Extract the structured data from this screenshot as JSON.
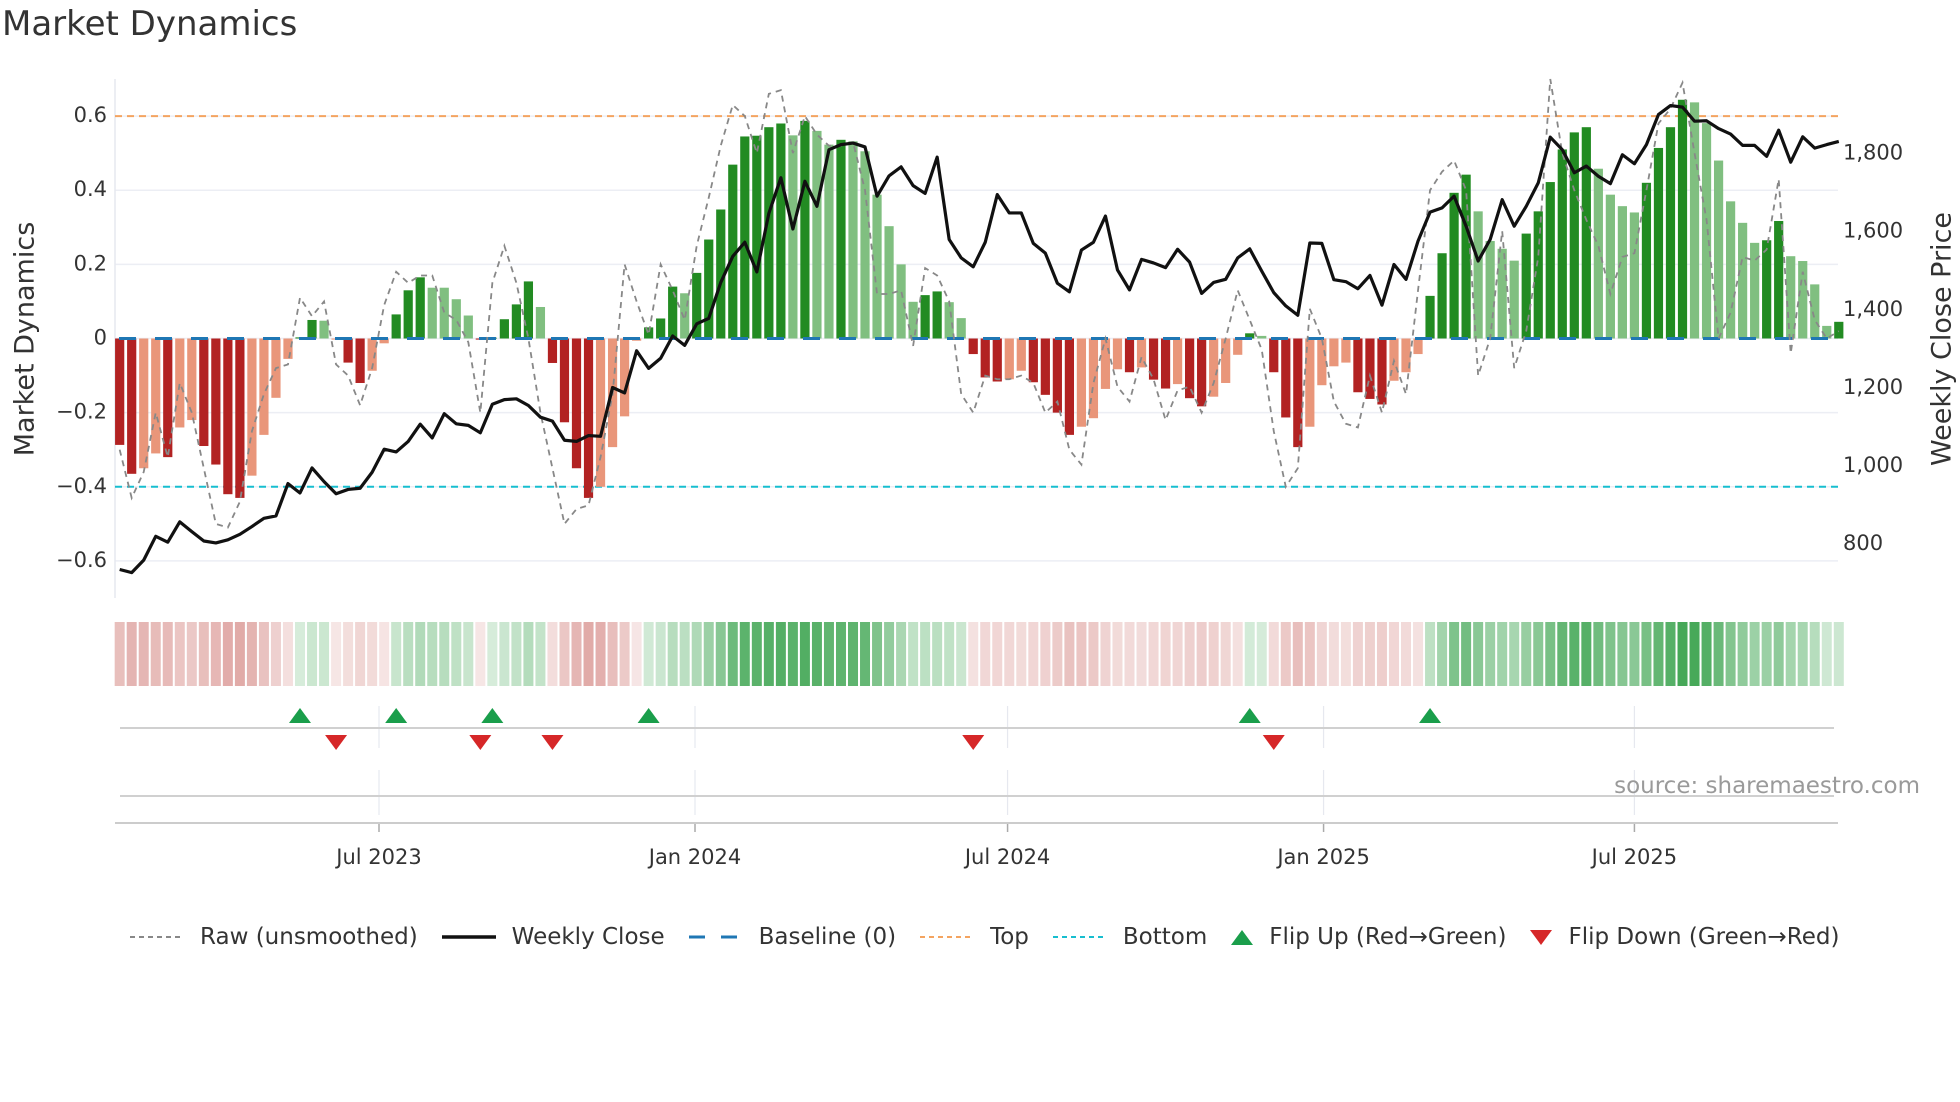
{
  "title": "Market Dynamics",
  "source": "source: sharemaestro.com",
  "colors": {
    "dark_red": "#b22222",
    "light_red": "#e9967a",
    "dark_green": "#228b22",
    "light_green": "#80bf80",
    "baseline": "#1f77b4",
    "top": "#f4a460",
    "bottom": "#17becf",
    "flip_up": "#1a9e4b",
    "flip_down": "#d62728",
    "close": "#111111",
    "raw": "#888888"
  },
  "legend": [
    {
      "key": "raw",
      "label": "Raw (unsmoothed)"
    },
    {
      "key": "close",
      "label": "Weekly Close"
    },
    {
      "key": "baseline",
      "label": "Baseline (0)"
    },
    {
      "key": "top",
      "label": "Top"
    },
    {
      "key": "bottom",
      "label": "Bottom"
    },
    {
      "key": "flip_up",
      "label": "Flip Up (Red→Green)"
    },
    {
      "key": "flip_down",
      "label": "Flip Down (Green→Red)"
    }
  ],
  "chart_data": {
    "type": "bar",
    "title": "Market Dynamics",
    "ylabel": "Market Dynamics",
    "y2label": "Weekly Close Price",
    "ylim": [
      -0.7,
      0.7
    ],
    "y2lim": [
      662,
      1991
    ],
    "yticks": [
      0.6,
      0.4,
      0.2,
      0,
      -0.2,
      -0.4,
      -0.6
    ],
    "ytick_labels": [
      "0.6",
      "0.4",
      "0.2",
      "0",
      "−0.2",
      "−0.4",
      "−0.6"
    ],
    "y2ticks": [
      800,
      1000,
      1200,
      1400,
      1600,
      1800
    ],
    "y2tick_labels": [
      "800",
      "1,000",
      "1,200",
      "1,400",
      "1,600",
      "1,800"
    ],
    "xticks": [
      "2023-07-01",
      "2024-01-01",
      "2024-07-01",
      "2025-01-01",
      "2025-07-01"
    ],
    "xtick_labels": [
      "Jul 2023",
      "Jan 2024",
      "Jul 2024",
      "Jan 2025",
      "Jul 2025"
    ],
    "start_date": "2023-01-31",
    "frequency_days": 7,
    "grid": true,
    "legend_position": "bottom",
    "top_level": 0.6,
    "bottom_level": -0.4,
    "baseline": 0,
    "dynamics": [
      -0.287,
      -0.365,
      -0.35,
      -0.31,
      -0.32,
      -0.24,
      -0.22,
      -0.29,
      -0.34,
      -0.42,
      -0.43,
      -0.37,
      -0.26,
      -0.16,
      -0.055,
      0.003,
      0.05,
      0.048,
      -0.003,
      -0.065,
      -0.12,
      -0.087,
      -0.013,
      0.065,
      0.13,
      0.165,
      0.137,
      0.137,
      0.106,
      0.062,
      -0.003,
      0.002,
      0.052,
      0.092,
      0.154,
      0.085,
      -0.066,
      -0.226,
      -0.35,
      -0.43,
      -0.4,
      -0.293,
      -0.21,
      -0.006,
      0.03,
      0.054,
      0.14,
      0.122,
      0.177,
      0.267,
      0.348,
      0.469,
      0.545,
      0.547,
      0.57,
      0.58,
      0.548,
      0.587,
      0.56,
      0.523,
      0.536,
      0.532,
      0.505,
      0.388,
      0.303,
      0.2,
      0.099,
      0.117,
      0.127,
      0.098,
      0.055,
      -0.042,
      -0.105,
      -0.116,
      -0.11,
      -0.087,
      -0.118,
      -0.152,
      -0.2,
      -0.26,
      -0.238,
      -0.215,
      -0.136,
      -0.083,
      -0.091,
      -0.078,
      -0.111,
      -0.135,
      -0.123,
      -0.161,
      -0.183,
      -0.157,
      -0.12,
      -0.044,
      0.014,
      0.007,
      -0.091,
      -0.213,
      -0.293,
      -0.238,
      -0.126,
      -0.075,
      -0.065,
      -0.145,
      -0.163,
      -0.178,
      -0.114,
      -0.091,
      -0.042,
      0.115,
      0.23,
      0.393,
      0.442,
      0.343,
      0.263,
      0.242,
      0.21,
      0.283,
      0.343,
      0.422,
      0.51,
      0.556,
      0.57,
      0.458,
      0.388,
      0.357,
      0.34,
      0.42,
      0.514,
      0.57,
      0.644,
      0.637,
      0.581,
      0.48,
      0.37,
      0.312,
      0.258,
      0.265,
      0.317,
      0.222,
      0.209,
      0.146,
      0.034,
      0.045
    ],
    "shade": "DDLLDLLDDDDLLLLDDLLDDLLDDDLLLLDDDDDLDDDDLLLLDDDLDDDDDDDDLDLLDLLLLLLDDLLDDDLLDDDDLLLLDLDDLDDLLLDLDDDLLLLDDDLLLDDDDLLLLDDDDDDLLLLDDDDLLLLLLDDLLLLD",
    "raw": [
      -0.3,
      -0.43,
      -0.36,
      -0.2,
      -0.32,
      -0.12,
      -0.2,
      -0.35,
      -0.5,
      -0.51,
      -0.44,
      -0.25,
      -0.15,
      -0.08,
      -0.07,
      0.11,
      0.06,
      0.1,
      -0.07,
      -0.1,
      -0.18,
      -0.08,
      0.09,
      0.18,
      0.15,
      0.17,
      0.17,
      0.07,
      0.05,
      -0.01,
      -0.2,
      0.15,
      0.25,
      0.15,
      0.0,
      -0.2,
      -0.35,
      -0.5,
      -0.46,
      -0.45,
      -0.32,
      -0.15,
      0.2,
      0.1,
      0.01,
      0.2,
      0.13,
      0.05,
      0.25,
      0.38,
      0.52,
      0.63,
      0.6,
      0.5,
      0.66,
      0.67,
      0.5,
      0.6,
      0.55,
      0.52,
      0.52,
      0.53,
      0.4,
      0.12,
      0.12,
      0.13,
      -0.02,
      0.19,
      0.17,
      0.1,
      -0.15,
      -0.2,
      -0.1,
      -0.11,
      -0.11,
      -0.1,
      -0.12,
      -0.2,
      -0.17,
      -0.3,
      -0.34,
      -0.12,
      0.0,
      -0.13,
      -0.17,
      -0.05,
      -0.11,
      -0.22,
      -0.14,
      -0.13,
      -0.2,
      -0.12,
      0.0,
      0.13,
      0.05,
      -0.03,
      -0.25,
      -0.4,
      -0.35,
      0.08,
      0.0,
      -0.17,
      -0.23,
      -0.24,
      -0.1,
      -0.2,
      -0.06,
      -0.15,
      0.13,
      0.4,
      0.45,
      0.48,
      0.4,
      -0.1,
      0.0,
      0.29,
      -0.08,
      0.02,
      0.22,
      0.7,
      0.5,
      0.4,
      0.32,
      0.25,
      0.12,
      0.22,
      0.23,
      0.4,
      0.58,
      0.62,
      0.69,
      0.5,
      0.32,
      0.0,
      0.07,
      0.22,
      0.21,
      0.24,
      0.43,
      -0.04,
      0.18,
      0.05,
      0.0,
      0.02
    ],
    "weekly_close": [
      735,
      727,
      759,
      820,
      805,
      857,
      832,
      808,
      803,
      811,
      825,
      845,
      866,
      872,
      955,
      931,
      995,
      960,
      929,
      940,
      943,
      984,
      1043,
      1036,
      1063,
      1107,
      1072,
      1134,
      1108,
      1104,
      1085,
      1158,
      1170,
      1172,
      1155,
      1125,
      1115,
      1066,
      1063,
      1078,
      1076,
      1201,
      1187,
      1295,
      1250,
      1276,
      1333,
      1309,
      1364,
      1378,
      1470,
      1537,
      1573,
      1497,
      1647,
      1738,
      1607,
      1729,
      1665,
      1810,
      1823,
      1827,
      1817,
      1691,
      1743,
      1766,
      1718,
      1698,
      1791,
      1580,
      1533,
      1510,
      1573,
      1695,
      1648,
      1648,
      1570,
      1545,
      1468,
      1446,
      1553,
      1573,
      1640,
      1502,
      1451,
      1529,
      1520,
      1508,
      1555,
      1522,
      1442,
      1470,
      1478,
      1533,
      1556,
      1499,
      1444,
      1410,
      1386,
      1571,
      1570,
      1477,
      1472,
      1454,
      1488,
      1412,
      1516,
      1478,
      1576,
      1650,
      1661,
      1691,
      1614,
      1525,
      1580,
      1682,
      1614,
      1665,
      1725,
      1842,
      1810,
      1751,
      1768,
      1742,
      1723,
      1797,
      1774,
      1823,
      1900,
      1923,
      1919,
      1883,
      1884,
      1864,
      1850,
      1821,
      1821,
      1793,
      1860,
      1778,
      1843,
      1814,
      1823,
      1831
    ],
    "flip_up_weeks": [
      15,
      23,
      31,
      44,
      94,
      109
    ],
    "flip_down_weeks": [
      18,
      30,
      36,
      71,
      96
    ]
  }
}
